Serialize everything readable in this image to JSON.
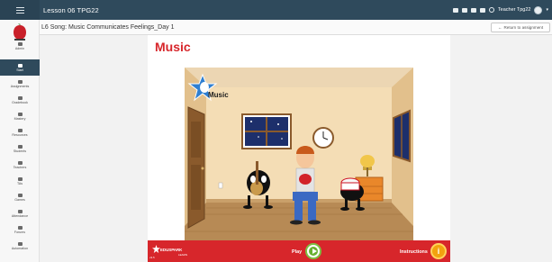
{
  "topbar": {
    "lesson_title": "Lesson 06 TPG22",
    "teacher_name": "Teacher Tpg22",
    "icons": [
      "mail-icon",
      "megaphone-icon",
      "list-icon",
      "calendar-icon",
      "search-icon"
    ]
  },
  "subbar": {
    "page_title": "L6 Song: Music Communicates Feelings_Day 1",
    "return_label": "Return to assignment"
  },
  "sidebar": {
    "items": [
      {
        "label": "Admin",
        "icon": "gear-icon"
      },
      {
        "label": "Start",
        "icon": "paper-plane-icon",
        "active": true
      },
      {
        "label": "Assignments",
        "icon": "document-icon"
      },
      {
        "label": "Gradebook",
        "icon": "grid-icon"
      },
      {
        "label": "Mastery",
        "icon": "chart-icon"
      },
      {
        "label": "Resources",
        "icon": "folder-icon"
      },
      {
        "label": "Students",
        "icon": "person-icon"
      },
      {
        "label": "Teachers",
        "icon": "person-icon"
      },
      {
        "label": "TAs",
        "icon": "person-icon"
      },
      {
        "label": "Games",
        "icon": "trophy-icon"
      },
      {
        "label": "Attendance",
        "icon": "check-icon"
      },
      {
        "label": "Forums",
        "icon": "forum-icon"
      },
      {
        "label": "Automation",
        "icon": "magic-wand-icon"
      }
    ]
  },
  "activity": {
    "heading": "Music",
    "scene_label": "Music"
  },
  "playbar": {
    "brand": "EDUSPARK",
    "brand_sub": "LEARN",
    "version": "v3.5",
    "play_label": "Play",
    "instructions_label": "Instructions",
    "info_glyph": "i"
  },
  "colors": {
    "topbar": "#2f4a5c",
    "accent_red": "#d7262b",
    "play_green": "#67b030",
    "info_orange": "#f2a20f"
  }
}
